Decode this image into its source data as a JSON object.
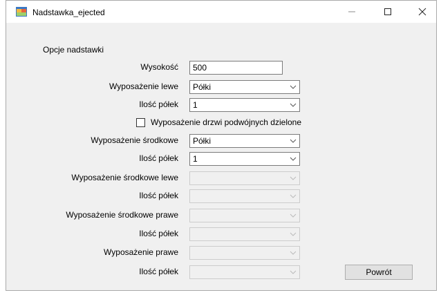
{
  "window": {
    "title": "Nadstawka_ejected",
    "minimize": "—",
    "maximize": "☐",
    "close": "✕"
  },
  "form": {
    "section_label": "Opcje nadstawki",
    "height": {
      "label": "Wysokość",
      "value": "500"
    },
    "left_equipment": {
      "label": "Wyposażenie lewe",
      "value": "Półki"
    },
    "left_shelves": {
      "label": "Ilość półek",
      "value": "1"
    },
    "double_door_checkbox": {
      "label": "Wyposażenie drzwi podwójnych dzielone",
      "checked": false
    },
    "middle_equipment": {
      "label": "Wyposażenie środkowe",
      "value": "Półki"
    },
    "middle_shelves": {
      "label": "Ilość półek",
      "value": "1"
    },
    "middle_left_equipment": {
      "label": "Wyposażenie środkowe lewe",
      "value": ""
    },
    "middle_left_shelves": {
      "label": "Ilość półek",
      "value": ""
    },
    "middle_right_equipment": {
      "label": "Wyposażenie środkowe prawe",
      "value": ""
    },
    "middle_right_shelves": {
      "label": "Ilość półek",
      "value": ""
    },
    "right_equipment": {
      "label": "Wyposażenie prawe",
      "value": ""
    },
    "right_shelves": {
      "label": "Ilość półek",
      "value": ""
    },
    "back_button": "Powrót"
  },
  "icons": {
    "app": "app-window-icon",
    "dropdown": "chevron-down-icon"
  },
  "colors": {
    "client_bg": "#f0f0f0",
    "disabled_border": "#cccccc",
    "enabled_border": "#7a7a7a",
    "button_bg": "#e1e1e1"
  }
}
